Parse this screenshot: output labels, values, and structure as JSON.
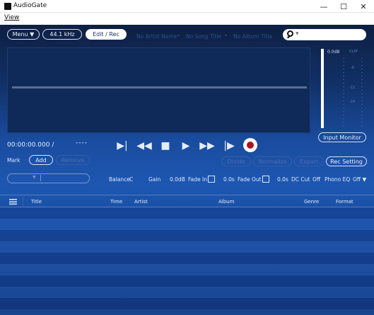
{
  "window": {
    "title": "AudioGate"
  },
  "window_controls": {
    "minimize": "—",
    "maximize": "☐",
    "close": "✕"
  },
  "menubar": {
    "view": "View"
  },
  "toolbar": {
    "menu_label": "Menu ▼",
    "sample_rate": "44.1 kHz",
    "edit_rec": "Edit / Rec",
    "artist_placeholder": "No Artist Name",
    "song_placeholder": "No Song Title",
    "album_placeholder": "No Album Title",
    "separator": "-"
  },
  "search": {
    "caret": "▼"
  },
  "meter": {
    "db_label": "0.0dB",
    "clip_label": "CLIP",
    "scale": [
      "-6",
      "-12",
      "-24"
    ]
  },
  "transport": {
    "time": "00:00:00.000 /",
    "remaining": "----",
    "skip_end": "▶|",
    "rewind": "◀◀",
    "stop": "■",
    "play": "▶",
    "fast_forward": "▶▶",
    "skip_next": "|▶"
  },
  "input_monitor": "Input Monitor",
  "mark": {
    "label": "Mark",
    "add": "Add",
    "remove": "Remove"
  },
  "edit_buttons": {
    "divide": "Divide",
    "normalize": "Normalize",
    "export": "Export",
    "rec_setting": "Rec Setting"
  },
  "controls": {
    "balance_label": "Balance",
    "balance_value": "C",
    "gain_label": "Gain",
    "gain_value": "0.0dB",
    "fade_in_label": "Fade In",
    "fade_in_value": "0.0s",
    "fade_out_label": "Fade Out",
    "fade_out_value": "0.0s",
    "dc_cut_label": "DC Cut",
    "dc_cut_value": "Off",
    "phono_eq_label": "Phono EQ",
    "phono_eq_value": "Off ▼"
  },
  "combo": {
    "arrow": "▼"
  },
  "table": {
    "columns": [
      "Title",
      "Time",
      "Artist",
      "Album",
      "Genre",
      "Format"
    ],
    "rows": []
  },
  "colors": {
    "accent": "#1d57b2",
    "record": "#b0121f",
    "text": "#e6edfb"
  }
}
